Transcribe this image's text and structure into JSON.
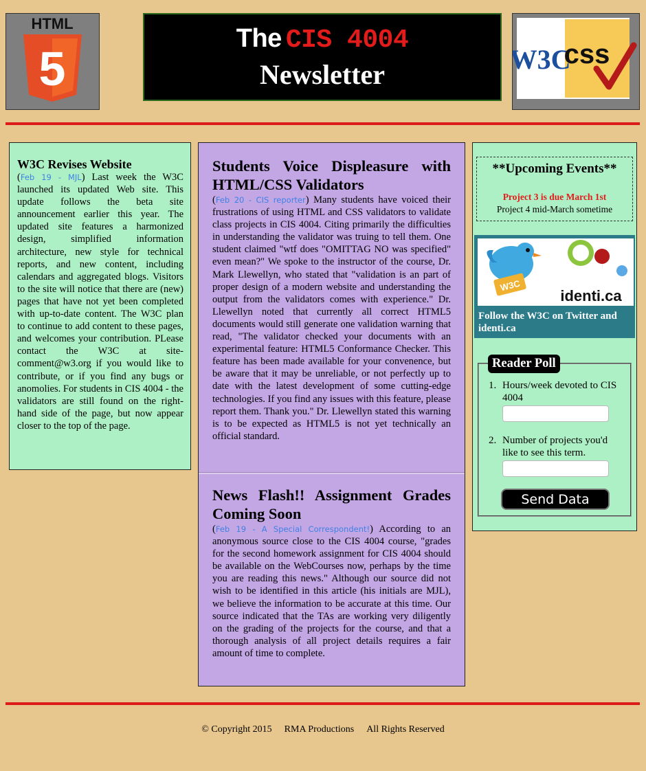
{
  "header": {
    "title_the": "The",
    "title_course": "CIS 4004",
    "title_newsletter": "Newsletter",
    "html5_logo_text": "HTML",
    "html5_logo_num": "5",
    "w3c_badge_left": "W3C",
    "w3c_badge_right": "css"
  },
  "left_article": {
    "title": "W3C Revises Website",
    "date": "Feb 19 - MJL",
    "body": "Last week the W3C launched its updated Web site. This update follows the beta site announcement earlier this year. The updated site features a harmonized design, simplified information architecture, new style for technical reports, and new content, including calendars and aggregated blogs. Visitors to the site will notice that there are (new) pages that have not yet been completed with up-to-date content. The W3C plan to continue to add content to these pages, and welcomes your contribution. PLease contact the W3C at site-comment@w3.org if you would like to contribute, or if you find any bugs or anomolies. For students in CIS 4004 - the validators are still found on the right-hand side of the page, but now appear closer to the top of the page."
  },
  "center_articles": [
    {
      "title": "Students Voice Displeasure with HTML/CSS Validators",
      "date": "Feb 20 - CIS reporter",
      "body": "Many students have voiced their frustrations of using HTML and CSS validators to validate class projects in CIS 4004. Citing primarily the difficulties in understanding the validator was truing to tell them. One student claimed \"wtf does \"OMITTAG NO was specified\" even mean?\" We spoke to the instructor of the course, Dr. Mark Llewellyn, who stated that \"validation is an part of proper design of a modern website and understanding the output from the validators comes with experience.\" Dr. Llewellyn noted that currently all correct HTML5 documents would still generate one validation warning that read, \"The validator checked your documents with an experimental feature: HTML5 Conformance Checker. This feature has been made available for your convenence, but be aware that it may be unreliable, or not perfectly up to date with the latest development of some cutting-edge technologies. If you find any issues with this feature, please report them. Thank you.\" Dr. Llewellyn stated this warning is to be expected as HTML5 is not yet technically an official standard."
    },
    {
      "title": "News Flash!! Assignment Grades Coming Soon",
      "date": "Feb 19 - A Special Correspondent!",
      "body": "According to an anonymous source close to the CIS 4004 course, \"grades for the second homework assignment for CIS 4004 should be available on the WebCourses now, perhaps by the time you are reading this news.\" Although our source did not wish to be identified in this article (his initials are MJL), we believe the information to be accurate at this time. Our source indicated that the TAs are working very diligently on the grading of the projects for the course, and that a thorough analysis of all project details requires a fair amount of time to complete."
    }
  ],
  "events": {
    "title": "**Upcoming Events**",
    "items": [
      "Project 3 is due March 1st",
      "Project 4 mid-March sometime"
    ]
  },
  "follow": {
    "twitter_badge": "W3C",
    "identica_label": "identi.ca",
    "caption": "Follow the W3C on Twitter and identi.ca"
  },
  "poll": {
    "legend": "Reader Poll",
    "questions": [
      {
        "num": "1.",
        "text": "Hours/week devoted to CIS 4004",
        "value": ""
      },
      {
        "num": "2.",
        "text": "Number of projects you'd like to see this term.",
        "value": ""
      }
    ],
    "submit_label": "Send Data"
  },
  "footer": {
    "copyright": "© Copyright 2015",
    "company": "RMA Productions",
    "rights": "All Rights Reserved"
  },
  "colors": {
    "page_bg": "#e8c78f",
    "green_panel": "#aef0c6",
    "purple_panel": "#c3a6e4",
    "accent_red": "#e21b1b",
    "date_blue": "#3f82e6",
    "twitter_bg": "#2b7b88"
  }
}
